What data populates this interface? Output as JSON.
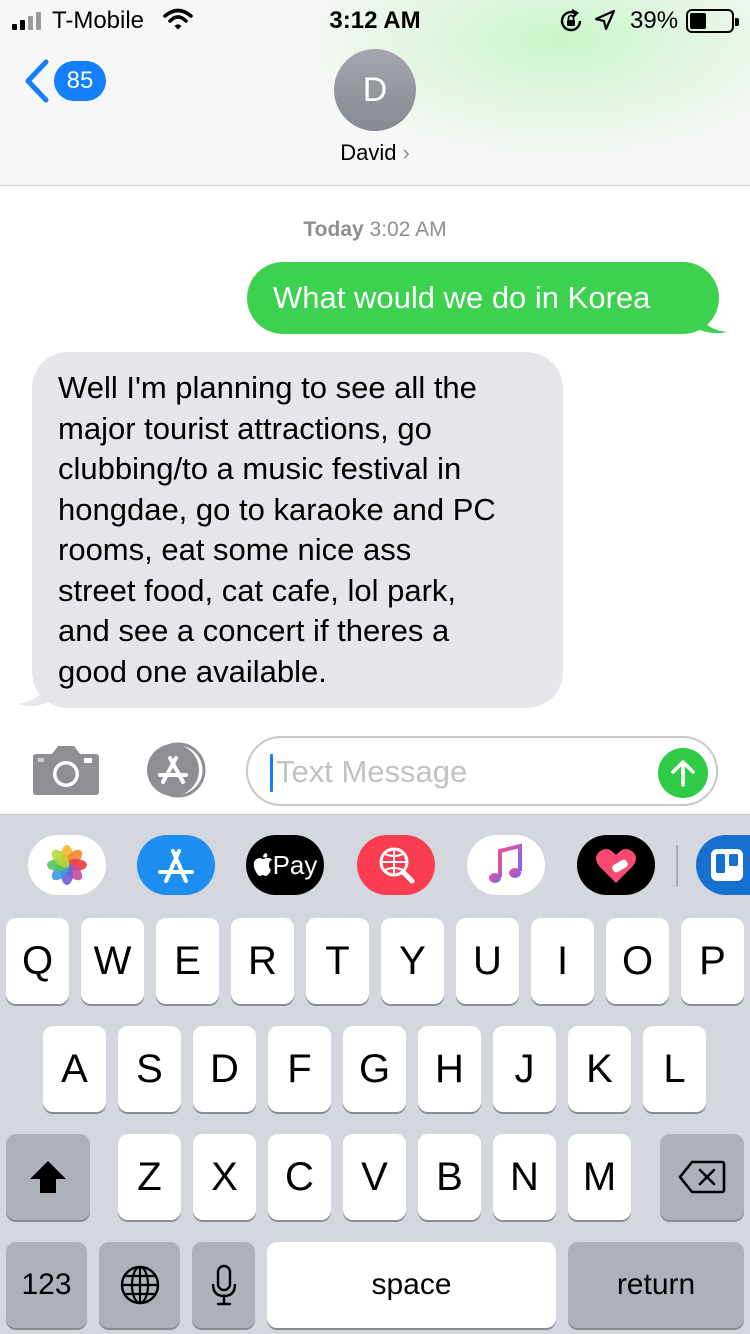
{
  "status_bar": {
    "carrier": "T-Mobile",
    "time": "3:12 AM",
    "battery": "39%",
    "battery_level": 0.39,
    "icons": [
      "signal-icon",
      "wifi-icon",
      "rotation-lock-icon",
      "location-icon",
      "battery-icon"
    ]
  },
  "header": {
    "back_count": "85",
    "avatar_initial": "D",
    "contact_name": "David",
    "chevron": "›"
  },
  "conversation": {
    "timestamp_day": "Today",
    "timestamp_time": "3:02 AM",
    "messages": [
      {
        "direction": "outgoing",
        "text": "What would we do in Korea"
      },
      {
        "direction": "incoming",
        "lines": [
          "Well I'm planning to see all the",
          "major tourist attractions, go",
          "clubbing/to a music festival in",
          "hongdae, go to karaoke and PC",
          "rooms, eat some nice ass",
          "street food, cat cafe, lol park,",
          "and see a concert if theres a",
          "good one available."
        ]
      }
    ]
  },
  "composer": {
    "placeholder": "Text Message"
  },
  "app_strip": {
    "apple_pay_label": "Pay",
    "apps": [
      "photos-icon",
      "app-store-icon",
      "apple-pay-icon",
      "web-search-icon",
      "music-icon",
      "heart-icon",
      "trello-icon"
    ]
  },
  "keyboard": {
    "row1": [
      "Q",
      "W",
      "E",
      "R",
      "T",
      "Y",
      "U",
      "I",
      "O",
      "P"
    ],
    "row2": [
      "A",
      "S",
      "D",
      "F",
      "G",
      "H",
      "J",
      "K",
      "L"
    ],
    "row3": [
      "Z",
      "X",
      "C",
      "V",
      "B",
      "N",
      "M"
    ],
    "numbers_label": "123",
    "space_label": "space",
    "return_label": "return"
  },
  "colors": {
    "imessage_blue": "#147efb",
    "sms_green": "#3cd14f",
    "incoming_gray": "#e5e5ea",
    "keyboard_bg": "#d4d7dd"
  }
}
